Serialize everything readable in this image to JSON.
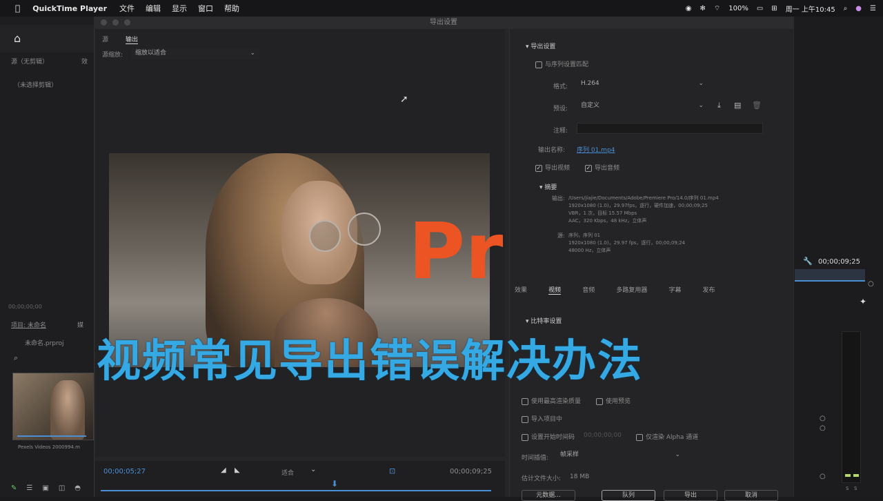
{
  "menubar": {
    "apple": "",
    "app_name": "QuickTime Player",
    "items": [
      "文件",
      "编辑",
      "显示",
      "窗口",
      "帮助"
    ],
    "battery": "100%",
    "clock": "周一 上午10:45"
  },
  "premiere_left": {
    "source_label": "源（无剪辑）",
    "effects_tab": "效",
    "no_clip": "（未选择剪辑）",
    "timecode": "00;00;00;00",
    "project_tab": "项目: 未命名",
    "media_tab": "媒",
    "project_file": "未命名.prproj",
    "thumb_label": "Pexels Videos 2000994.m"
  },
  "dialog": {
    "title": "导出设置",
    "tabs": [
      "源",
      "输出"
    ],
    "source_scaling_label": "源缩放:",
    "source_scaling_value": "缩放以适合",
    "playhead_time": "00;00;05;27",
    "fit_value": "适合",
    "end_time": "00;00;09;25"
  },
  "export_settings": {
    "section_title": "导出设置",
    "match_sequence": "与序列设置匹配",
    "format_label": "格式:",
    "format_value": "H.264",
    "preset_label": "预设:",
    "preset_value": "自定义",
    "comments_label": "注释:",
    "output_name_label": "输出名称:",
    "output_name_value": "序列 01.mp4",
    "export_video": "导出视频",
    "export_audio": "导出音频",
    "summary_title": "摘要",
    "summary_output_label": "输出:",
    "summary_output_lines": [
      "/Users/jiajie/Documents/Adobe/Premiere Pro/14.0/序列 01.mp4",
      "1920x1080 (1.0)，29.97fps，逐行，硬件加速，00;00;09;25",
      "VBR，1 次，目标 15.57 Mbps",
      "AAC，320 Kbps，48 kHz，立体声"
    ],
    "summary_source_label": "源:",
    "summary_source_lines": [
      "序列，序列 01",
      "1920x1080 (1.0)，29.97 fps，逐行，00;00;09;24",
      "48000 Hz，立体声"
    ],
    "tabs": [
      "效果",
      "视频",
      "音频",
      "多路复用器",
      "字幕",
      "发布"
    ],
    "bitrate_section": "比特率设置",
    "max_render_quality": "使用最高渲染质量",
    "use_previews": "使用预览",
    "import_project": "导入项目中",
    "set_start_timecode": "设置开始时间码",
    "start_timecode_value": "00;00;00;00",
    "render_alpha_only": "仅渲染 Alpha 通道",
    "time_interpolation_label": "时间插值:",
    "time_interpolation_value": "帧采样",
    "estimated_size_label": "估计文件大小:",
    "estimated_size_value": "18 MB",
    "buttons": [
      "元数据...",
      "队列",
      "导出",
      "取消"
    ]
  },
  "premiere_right": {
    "timecode": "00;00;09;25",
    "meter_labels": [
      "S",
      "S"
    ]
  },
  "overlay": {
    "logo": "Pr",
    "title": "视频常见导出错误解决办法"
  },
  "colors": {
    "title_blue": "#35a9e4",
    "pr_orange": "#ec5523",
    "accent_blue": "#4a90d9"
  }
}
